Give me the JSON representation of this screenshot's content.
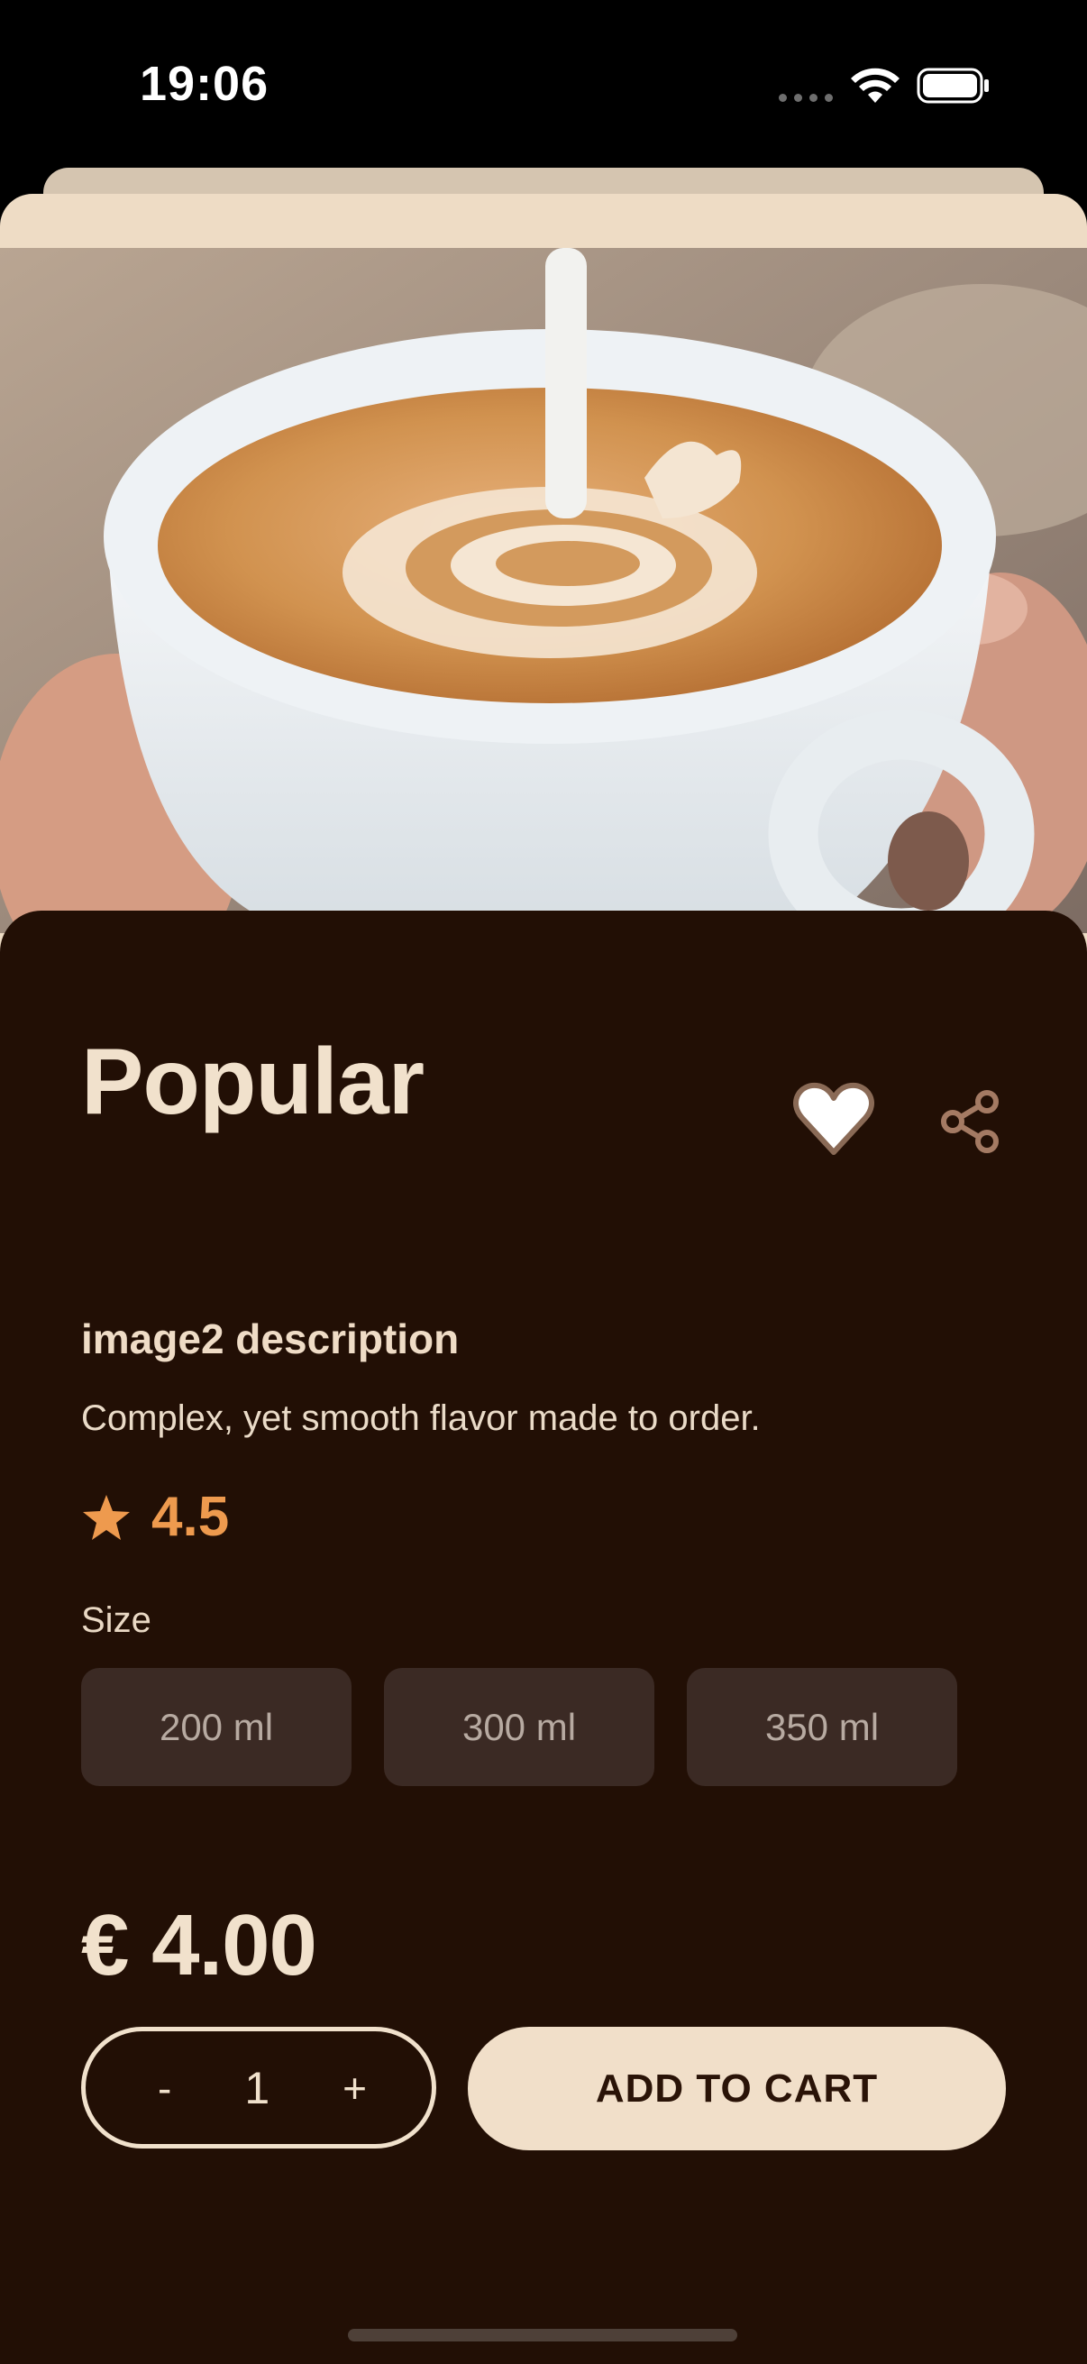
{
  "status_bar": {
    "time": "19:06"
  },
  "product": {
    "title": "Popular",
    "description_title": "image2 description",
    "description": "Complex, yet smooth flavor made to order.",
    "rating": "4.5"
  },
  "sizes": {
    "label": "Size",
    "options": [
      "200 ml",
      "300 ml",
      "350 ml"
    ]
  },
  "price": "€ 4.00",
  "quantity": {
    "decrement": "-",
    "value": "1",
    "increment": "+"
  },
  "add_to_cart": "ADD TO CART",
  "colors": {
    "background": "#000000",
    "panel": "#220f05",
    "sheet": "#eedcc5",
    "text_primary": "#f1e1cc",
    "rating_accent": "#ee9a4e",
    "size_chip": "#3b2a24",
    "button_fill": "#f1dfc9"
  },
  "icons": [
    "wifi-icon",
    "battery-icon",
    "heart-icon",
    "share-icon",
    "star-icon"
  ]
}
